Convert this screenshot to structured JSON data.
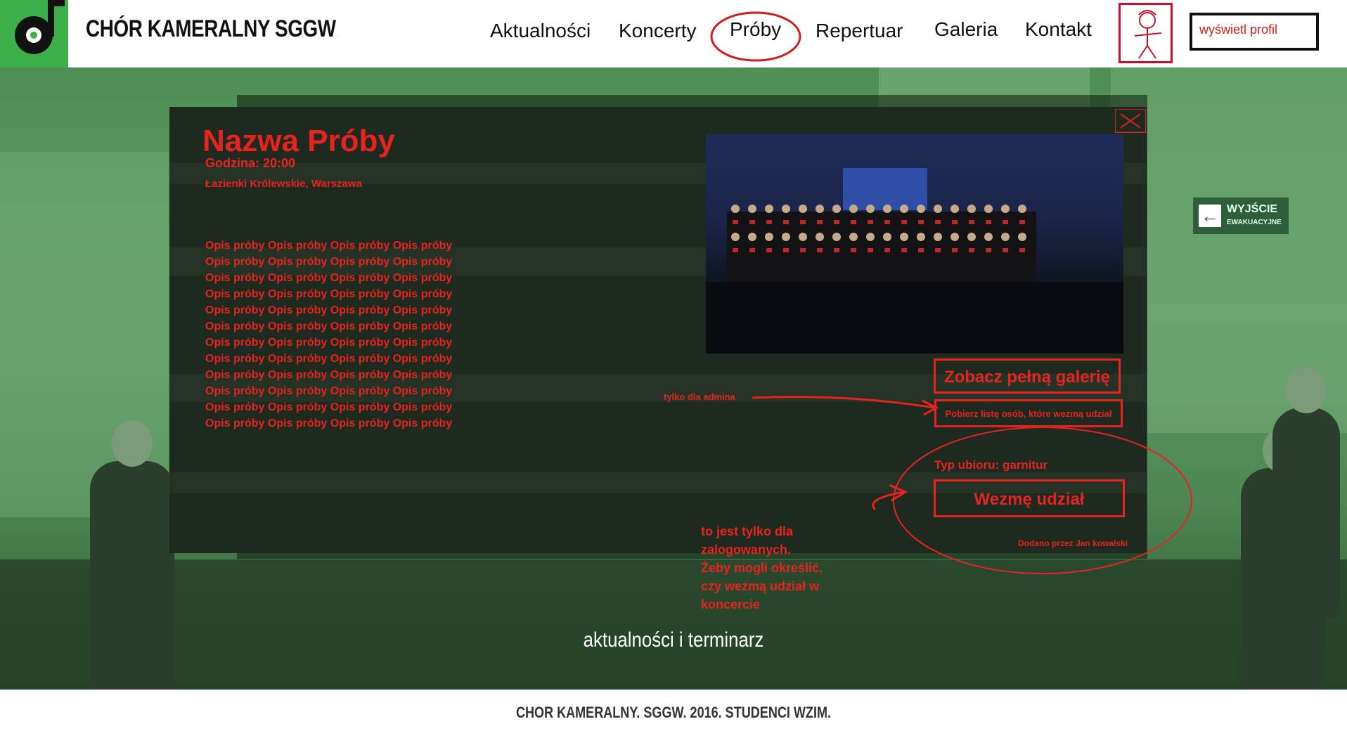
{
  "header": {
    "site_title": "CHÓR KAMERALNY SGGW",
    "nav": [
      "Aktualności",
      "Koncerty",
      "Próby",
      "Repertuar",
      "Galeria",
      "Kontakt"
    ],
    "active_nav": "Próby",
    "profile_label": "wyświetl profil"
  },
  "hero": {
    "exit_sign_main": "WYJŚCIE",
    "exit_sign_sub": "EWAKUACYJNE",
    "section_label": "aktualności i terminarz"
  },
  "rehearsal": {
    "title": "Nazwa Próby",
    "time": "Godzina: 20:00",
    "place": "Łazienki Królewskie, Warszawa",
    "description_line": "Opis próby Opis próby Opis próby Opis próby",
    "description_line_count": 12,
    "gallery_button": "Zobacz pełną galerię",
    "download_list_button": "Pobierz listę osób, które wezmą udział",
    "dress_code": "Typ ubioru: garnitur",
    "join_button": "Wezmę udział",
    "added_by": "Dodano przez Jan kowalski"
  },
  "annotations": {
    "admin_only": "tylko dla admina",
    "logged_in_note": [
      "to jest tylko dla",
      "zalogowanych.",
      "Żeby mogli określić,",
      "czy wezmą udział w",
      "koncercie"
    ]
  },
  "footer": {
    "text": "CHOR KAMERALNY. SGGW. 2016. STUDENCI WZIM."
  },
  "colors": {
    "accent_red": "#e8231f",
    "logo_green": "#3cb04a",
    "modal_bg": "#1e2a1f"
  }
}
